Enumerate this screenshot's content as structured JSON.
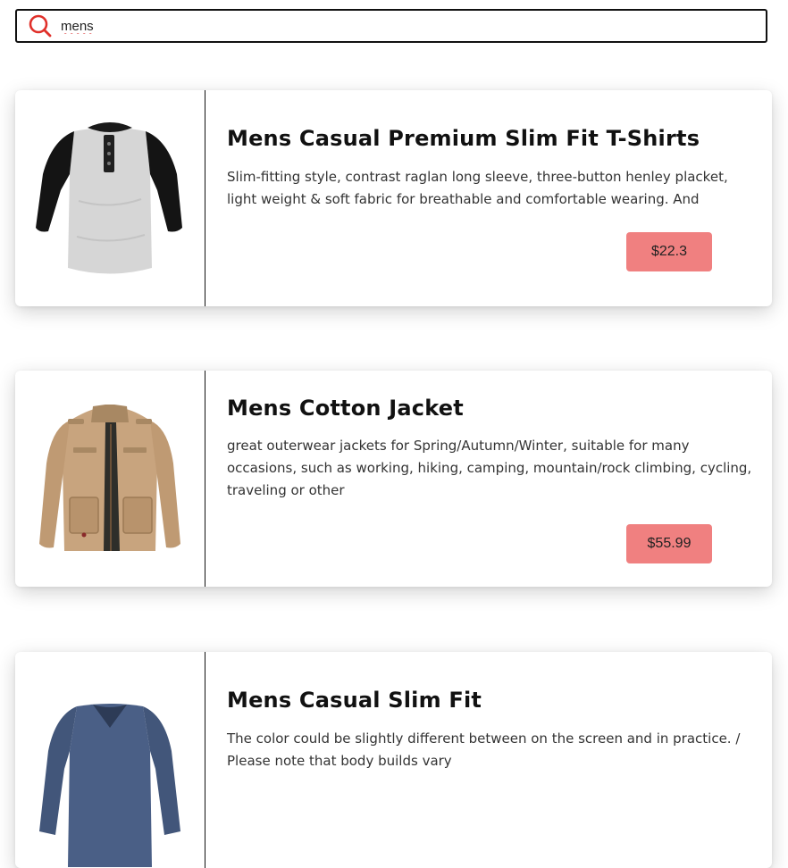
{
  "search": {
    "value": "mens",
    "placeholder": ""
  },
  "products": [
    {
      "title": "Mens Casual Premium Slim Fit T-Shirts",
      "description": "Slim-fitting style, contrast raglan long sleeve, three-button henley placket, light weight & soft fabric for breathable and comfortable wearing. And",
      "price": "$22.3",
      "image": "raglan-henley-shirt"
    },
    {
      "title": "Mens Cotton Jacket",
      "description": "great outerwear jackets for Spring/Autumn/Winter, suitable for many occasions, such as working, hiking, camping, mountain/rock climbing, cycling, traveling or other",
      "price": "$55.99",
      "image": "khaki-cotton-jacket"
    },
    {
      "title": "Mens Casual Slim Fit",
      "description": "The color could be slightly different between on the screen and in practice. / Please note that body builds vary",
      "price": "",
      "image": "blue-long-sleeve-shirt"
    }
  ],
  "colors": {
    "price_button": "#f08080",
    "search_icon": "#e0302a",
    "border": "#111111"
  }
}
